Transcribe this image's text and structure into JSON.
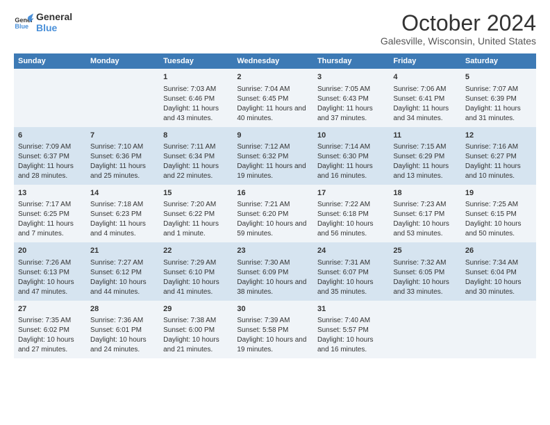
{
  "logo": {
    "line1": "General",
    "line2": "Blue"
  },
  "title": "October 2024",
  "subtitle": "Galesville, Wisconsin, United States",
  "weekdays": [
    "Sunday",
    "Monday",
    "Tuesday",
    "Wednesday",
    "Thursday",
    "Friday",
    "Saturday"
  ],
  "weeks": [
    [
      {
        "day": "",
        "info": ""
      },
      {
        "day": "",
        "info": ""
      },
      {
        "day": "1",
        "info": "Sunrise: 7:03 AM\nSunset: 6:46 PM\nDaylight: 11 hours and 43 minutes."
      },
      {
        "day": "2",
        "info": "Sunrise: 7:04 AM\nSunset: 6:45 PM\nDaylight: 11 hours and 40 minutes."
      },
      {
        "day": "3",
        "info": "Sunrise: 7:05 AM\nSunset: 6:43 PM\nDaylight: 11 hours and 37 minutes."
      },
      {
        "day": "4",
        "info": "Sunrise: 7:06 AM\nSunset: 6:41 PM\nDaylight: 11 hours and 34 minutes."
      },
      {
        "day": "5",
        "info": "Sunrise: 7:07 AM\nSunset: 6:39 PM\nDaylight: 11 hours and 31 minutes."
      }
    ],
    [
      {
        "day": "6",
        "info": "Sunrise: 7:09 AM\nSunset: 6:37 PM\nDaylight: 11 hours and 28 minutes."
      },
      {
        "day": "7",
        "info": "Sunrise: 7:10 AM\nSunset: 6:36 PM\nDaylight: 11 hours and 25 minutes."
      },
      {
        "day": "8",
        "info": "Sunrise: 7:11 AM\nSunset: 6:34 PM\nDaylight: 11 hours and 22 minutes."
      },
      {
        "day": "9",
        "info": "Sunrise: 7:12 AM\nSunset: 6:32 PM\nDaylight: 11 hours and 19 minutes."
      },
      {
        "day": "10",
        "info": "Sunrise: 7:14 AM\nSunset: 6:30 PM\nDaylight: 11 hours and 16 minutes."
      },
      {
        "day": "11",
        "info": "Sunrise: 7:15 AM\nSunset: 6:29 PM\nDaylight: 11 hours and 13 minutes."
      },
      {
        "day": "12",
        "info": "Sunrise: 7:16 AM\nSunset: 6:27 PM\nDaylight: 11 hours and 10 minutes."
      }
    ],
    [
      {
        "day": "13",
        "info": "Sunrise: 7:17 AM\nSunset: 6:25 PM\nDaylight: 11 hours and 7 minutes."
      },
      {
        "day": "14",
        "info": "Sunrise: 7:18 AM\nSunset: 6:23 PM\nDaylight: 11 hours and 4 minutes."
      },
      {
        "day": "15",
        "info": "Sunrise: 7:20 AM\nSunset: 6:22 PM\nDaylight: 11 hours and 1 minute."
      },
      {
        "day": "16",
        "info": "Sunrise: 7:21 AM\nSunset: 6:20 PM\nDaylight: 10 hours and 59 minutes."
      },
      {
        "day": "17",
        "info": "Sunrise: 7:22 AM\nSunset: 6:18 PM\nDaylight: 10 hours and 56 minutes."
      },
      {
        "day": "18",
        "info": "Sunrise: 7:23 AM\nSunset: 6:17 PM\nDaylight: 10 hours and 53 minutes."
      },
      {
        "day": "19",
        "info": "Sunrise: 7:25 AM\nSunset: 6:15 PM\nDaylight: 10 hours and 50 minutes."
      }
    ],
    [
      {
        "day": "20",
        "info": "Sunrise: 7:26 AM\nSunset: 6:13 PM\nDaylight: 10 hours and 47 minutes."
      },
      {
        "day": "21",
        "info": "Sunrise: 7:27 AM\nSunset: 6:12 PM\nDaylight: 10 hours and 44 minutes."
      },
      {
        "day": "22",
        "info": "Sunrise: 7:29 AM\nSunset: 6:10 PM\nDaylight: 10 hours and 41 minutes."
      },
      {
        "day": "23",
        "info": "Sunrise: 7:30 AM\nSunset: 6:09 PM\nDaylight: 10 hours and 38 minutes."
      },
      {
        "day": "24",
        "info": "Sunrise: 7:31 AM\nSunset: 6:07 PM\nDaylight: 10 hours and 35 minutes."
      },
      {
        "day": "25",
        "info": "Sunrise: 7:32 AM\nSunset: 6:05 PM\nDaylight: 10 hours and 33 minutes."
      },
      {
        "day": "26",
        "info": "Sunrise: 7:34 AM\nSunset: 6:04 PM\nDaylight: 10 hours and 30 minutes."
      }
    ],
    [
      {
        "day": "27",
        "info": "Sunrise: 7:35 AM\nSunset: 6:02 PM\nDaylight: 10 hours and 27 minutes."
      },
      {
        "day": "28",
        "info": "Sunrise: 7:36 AM\nSunset: 6:01 PM\nDaylight: 10 hours and 24 minutes."
      },
      {
        "day": "29",
        "info": "Sunrise: 7:38 AM\nSunset: 6:00 PM\nDaylight: 10 hours and 21 minutes."
      },
      {
        "day": "30",
        "info": "Sunrise: 7:39 AM\nSunset: 5:58 PM\nDaylight: 10 hours and 19 minutes."
      },
      {
        "day": "31",
        "info": "Sunrise: 7:40 AM\nSunset: 5:57 PM\nDaylight: 10 hours and 16 minutes."
      },
      {
        "day": "",
        "info": ""
      },
      {
        "day": "",
        "info": ""
      }
    ]
  ]
}
